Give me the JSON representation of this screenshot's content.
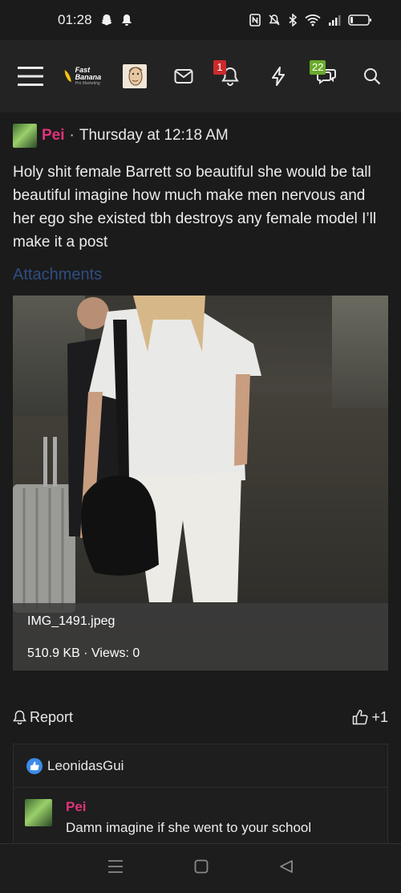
{
  "status_bar": {
    "time": "01:28",
    "left_icons": [
      "snapchat-icon",
      "bell-icon"
    ],
    "right_icons": [
      "nfc-icon",
      "mute-icon",
      "bluetooth-icon",
      "wifi-icon",
      "signal-icon",
      "battery-icon"
    ]
  },
  "header": {
    "menu_icon": "hamburger-icon",
    "logo_title": "Fast Banana",
    "logo_subtitle": "Pro Marketing",
    "mail_icon": "mail-icon",
    "alerts_badge": "1",
    "alerts_badge_color": "#cc2a2a",
    "bolt_icon": "bolt-icon",
    "conversations_badge": "22",
    "conversations_badge_color": "#6aaa2b",
    "search_icon": "search-icon"
  },
  "post": {
    "author": "Pei",
    "author_color": "#e0327a",
    "separator": "·",
    "timestamp": "Thursday at 12:18 AM",
    "body": "Holy shit female Barrett so beautiful she would be tall beautiful imagine how much make men nervous and her ego she existed tbh destroys any female model I’ll make it a post",
    "attachments_heading": "Attachments",
    "attachment": {
      "file_name": "IMG_1491.jpeg",
      "file_info": "510.9 KB · Views: 0"
    },
    "report_label": "Report",
    "like_label": "+1"
  },
  "reactions": {
    "reactor": "LeonidasGui"
  },
  "comment": {
    "author": "Pei",
    "text": "Damn imagine if she went to your school"
  },
  "nav": {
    "icons": [
      "recent-apps-icon",
      "home-icon",
      "back-icon"
    ]
  }
}
